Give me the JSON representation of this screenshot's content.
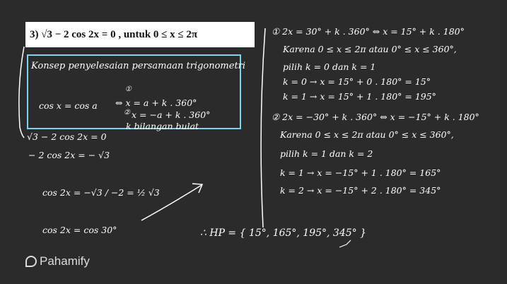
{
  "problem": "3)  √3 − 2 cos 2x = 0 , untuk 0 ≤ x ≤ 2π",
  "concept": {
    "title": "Konsep penyelesaian persamaan trigonometri",
    "lhs": "cos x = cos a",
    "case1_mark": "①",
    "case1": "⇔ x = a + k . 360°",
    "case2_mark": "②",
    "case2": "x = −a + k . 360°",
    "note": "k bilangan bulat"
  },
  "left_steps": [
    "√3 − 2 cos 2x = 0",
    "− 2 cos 2x = − √3",
    "cos 2x = −√3 / −2 = ½ √3",
    "cos 2x = cos 30°"
  ],
  "right_steps": [
    "① 2x = 30° + k . 360° ⇔ x = 15° + k . 180°",
    "Karena 0 ≤ x ≤ 2π atau 0° ≤ x ≤ 360°,",
    "pilih k = 0 dan k = 1",
    "k = 0 → x = 15° + 0 . 180° = 15°",
    "k = 1 → x = 15° + 1 . 180° = 195°",
    "② 2x = −30° + k . 360° ⇔ x = −15° + k . 180°",
    "Karena 0 ≤ x ≤ 2π atau 0° ≤ x ≤ 360°,",
    "pilih k = 1 dan k = 2",
    "k = 1 → x = −15° + 1 . 180° = 165°",
    "k = 2 → x = −15° + 2 . 180° = 345°"
  ],
  "answer": "∴ HP = { 15°, 165°, 195°, 345° }",
  "logo": "Pahamify",
  "colors": {
    "background": "#2b2b2b",
    "box_border": "#7fd3ee",
    "ink": "#ffffff"
  }
}
